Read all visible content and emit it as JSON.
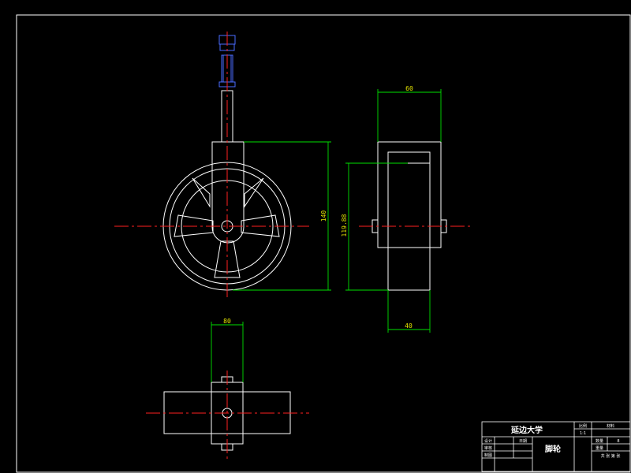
{
  "dimensions": {
    "top_view_width": "80",
    "side_view_width": "60",
    "front_height": "140",
    "front_height_inner": "119.88",
    "side_bottom_width": "40"
  },
  "title_block": {
    "university": "延边大学",
    "part_name": "脚轮",
    "scale_label": "比例",
    "scale_value": "1:1",
    "material_label": "材料",
    "quantity_label": "数量",
    "quantity_value": "8",
    "weight_label": "重量",
    "sheet_text": "共 张 第 张",
    "designer_label": "设计",
    "checker_label": "审核",
    "drawn_label": "制图",
    "date_label": "日期",
    "designer_name": "",
    "date_value": ""
  },
  "colors": {
    "background": "#000000",
    "outline": "#ffffff",
    "centerline": "#ff2020",
    "dimension": "#00e000",
    "dimension_text": "#e8e800",
    "bolt_head": "#4a6cff"
  }
}
